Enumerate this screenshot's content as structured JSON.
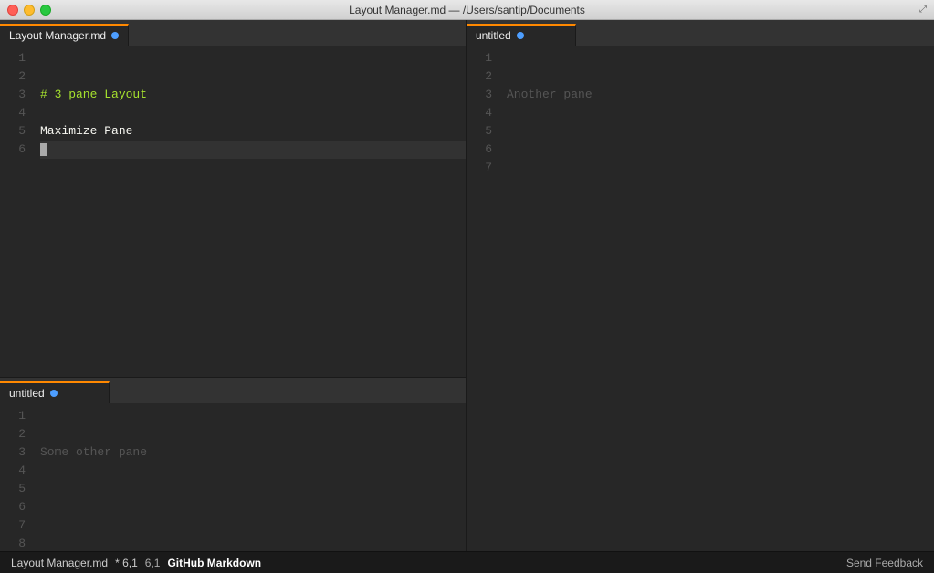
{
  "window": {
    "title": "Layout Manager.md — /Users/santip/Documents"
  },
  "panes": {
    "top_left": {
      "tab_label": "Layout Manager.md",
      "lines": [
        {
          "num": "1",
          "content": "",
          "type": "empty"
        },
        {
          "num": "2",
          "content": "",
          "type": "empty"
        },
        {
          "num": "3",
          "content": "# 3 pane Layout",
          "type": "heading"
        },
        {
          "num": "4",
          "content": "",
          "type": "empty"
        },
        {
          "num": "5",
          "content": "Maximize Pane",
          "type": "text"
        },
        {
          "num": "6",
          "content": "",
          "type": "cursor"
        }
      ]
    },
    "bottom_left": {
      "tab_label": "untitled",
      "lines": [
        {
          "num": "1",
          "content": "",
          "type": "empty"
        },
        {
          "num": "2",
          "content": "",
          "type": "empty"
        },
        {
          "num": "3",
          "content": "Some other pane",
          "type": "placeholder"
        },
        {
          "num": "4",
          "content": "",
          "type": "empty"
        },
        {
          "num": "5",
          "content": "",
          "type": "empty"
        },
        {
          "num": "6",
          "content": "",
          "type": "empty"
        },
        {
          "num": "7",
          "content": "",
          "type": "empty"
        },
        {
          "num": "8",
          "content": "",
          "type": "empty"
        }
      ]
    },
    "right": {
      "tab_label": "untitled",
      "lines": [
        {
          "num": "1",
          "content": "",
          "type": "empty"
        },
        {
          "num": "2",
          "content": "",
          "type": "empty"
        },
        {
          "num": "3",
          "content": "Another pane",
          "type": "placeholder"
        },
        {
          "num": "4",
          "content": "",
          "type": "empty"
        },
        {
          "num": "5",
          "content": "",
          "type": "empty"
        },
        {
          "num": "6",
          "content": "",
          "type": "empty"
        },
        {
          "num": "7",
          "content": "",
          "type": "empty"
        }
      ]
    }
  },
  "status_bar": {
    "filename": "Layout Manager.md",
    "modified_marker": "*",
    "position": "6,1",
    "grammar": "GitHub Markdown",
    "feedback": "Send Feedback"
  },
  "icons": {
    "maximize": "⤢"
  }
}
